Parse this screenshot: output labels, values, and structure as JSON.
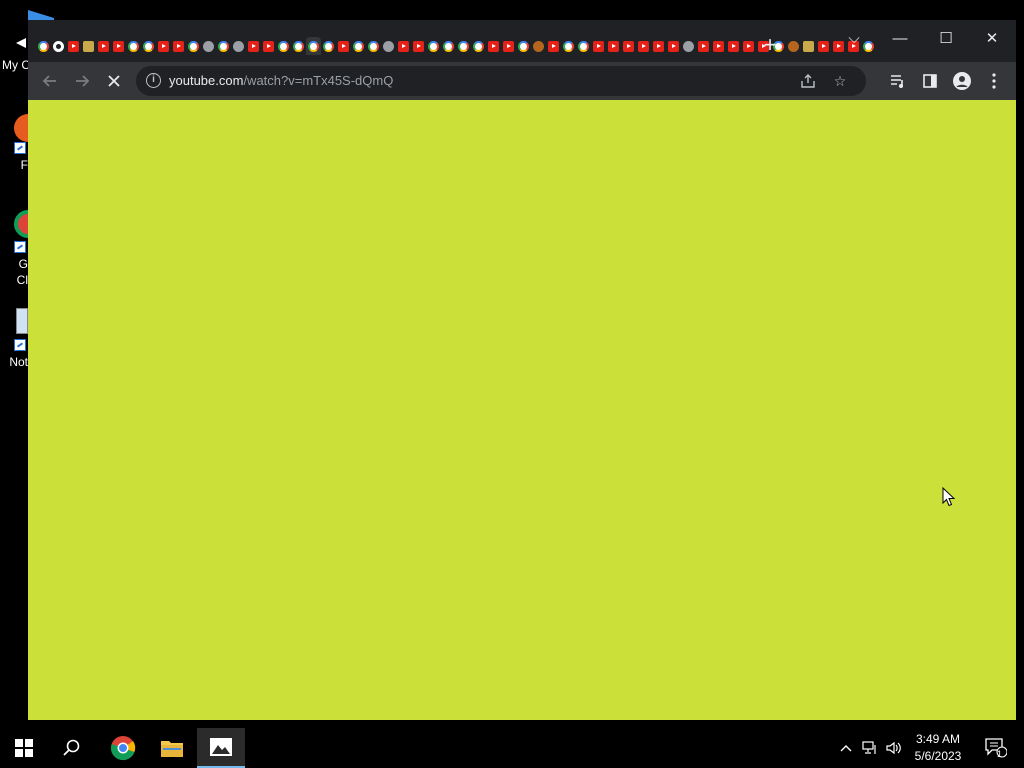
{
  "desktop": {
    "icons": [
      {
        "label": "My C"
      },
      {
        "label": "F"
      },
      {
        "label": "G"
      },
      {
        "label": "Cl"
      },
      {
        "label": "Not"
      }
    ]
  },
  "browser": {
    "new_tab_label": "+",
    "window_controls": {
      "tab_search": "⌵",
      "minimize": "—",
      "maximize": "☐",
      "close": "✕"
    },
    "address": {
      "host": "youtube.com",
      "path": "/watch?v=mTx45S-dQmQ"
    },
    "page_background": "#cce03a",
    "loading": true
  },
  "taskbar": {
    "time": "3:49 AM",
    "date": "5/6/2023",
    "notification_count": "1"
  }
}
